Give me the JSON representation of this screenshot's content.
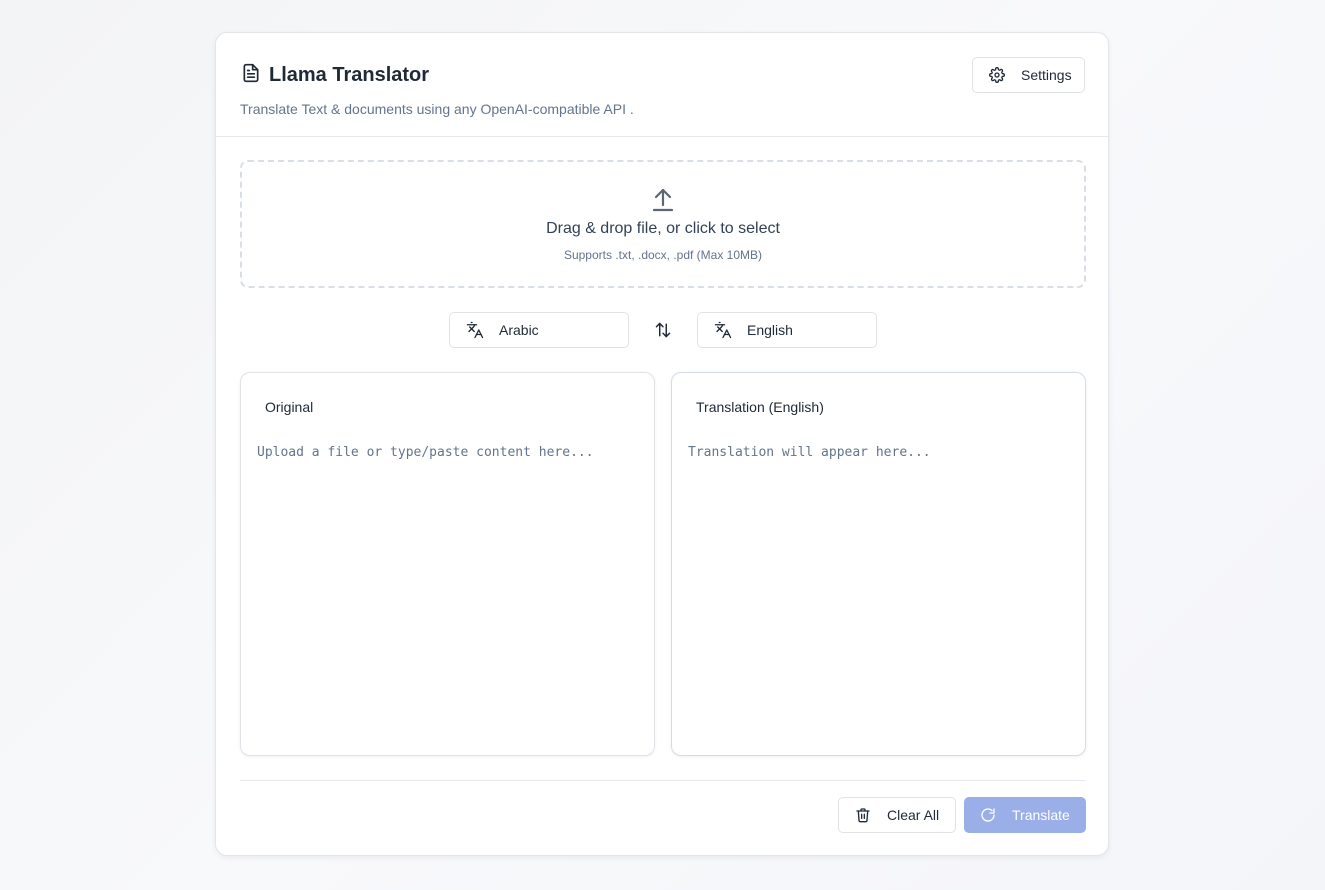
{
  "app": {
    "title": "Llama Translator",
    "subtitle": "Translate Text & documents using any OpenAI-compatible API .",
    "icon": "document-icon"
  },
  "header": {
    "settings_label": "Settings",
    "settings_icon": "gear-icon"
  },
  "dropzone": {
    "icon": "upload-icon",
    "title": "Drag & drop file, or click to select",
    "subtitle": "Supports .txt, .docx, .pdf (Max 10MB)"
  },
  "languages": {
    "source": "Arabic",
    "target": "English",
    "icon": "translate-icon",
    "swap_icon": "swap-arrows-icon"
  },
  "panels": {
    "original": {
      "title": "Original",
      "value": "",
      "placeholder": "Upload a file or type/paste content here..."
    },
    "translation": {
      "title": "Translation (English)",
      "placeholder": "Translation will appear here..."
    }
  },
  "actions": {
    "clear_label": "Clear All",
    "clear_icon": "trash-icon",
    "translate_label": "Translate",
    "translate_icon": "refresh-icon",
    "translate_color": "#9aaee8"
  }
}
